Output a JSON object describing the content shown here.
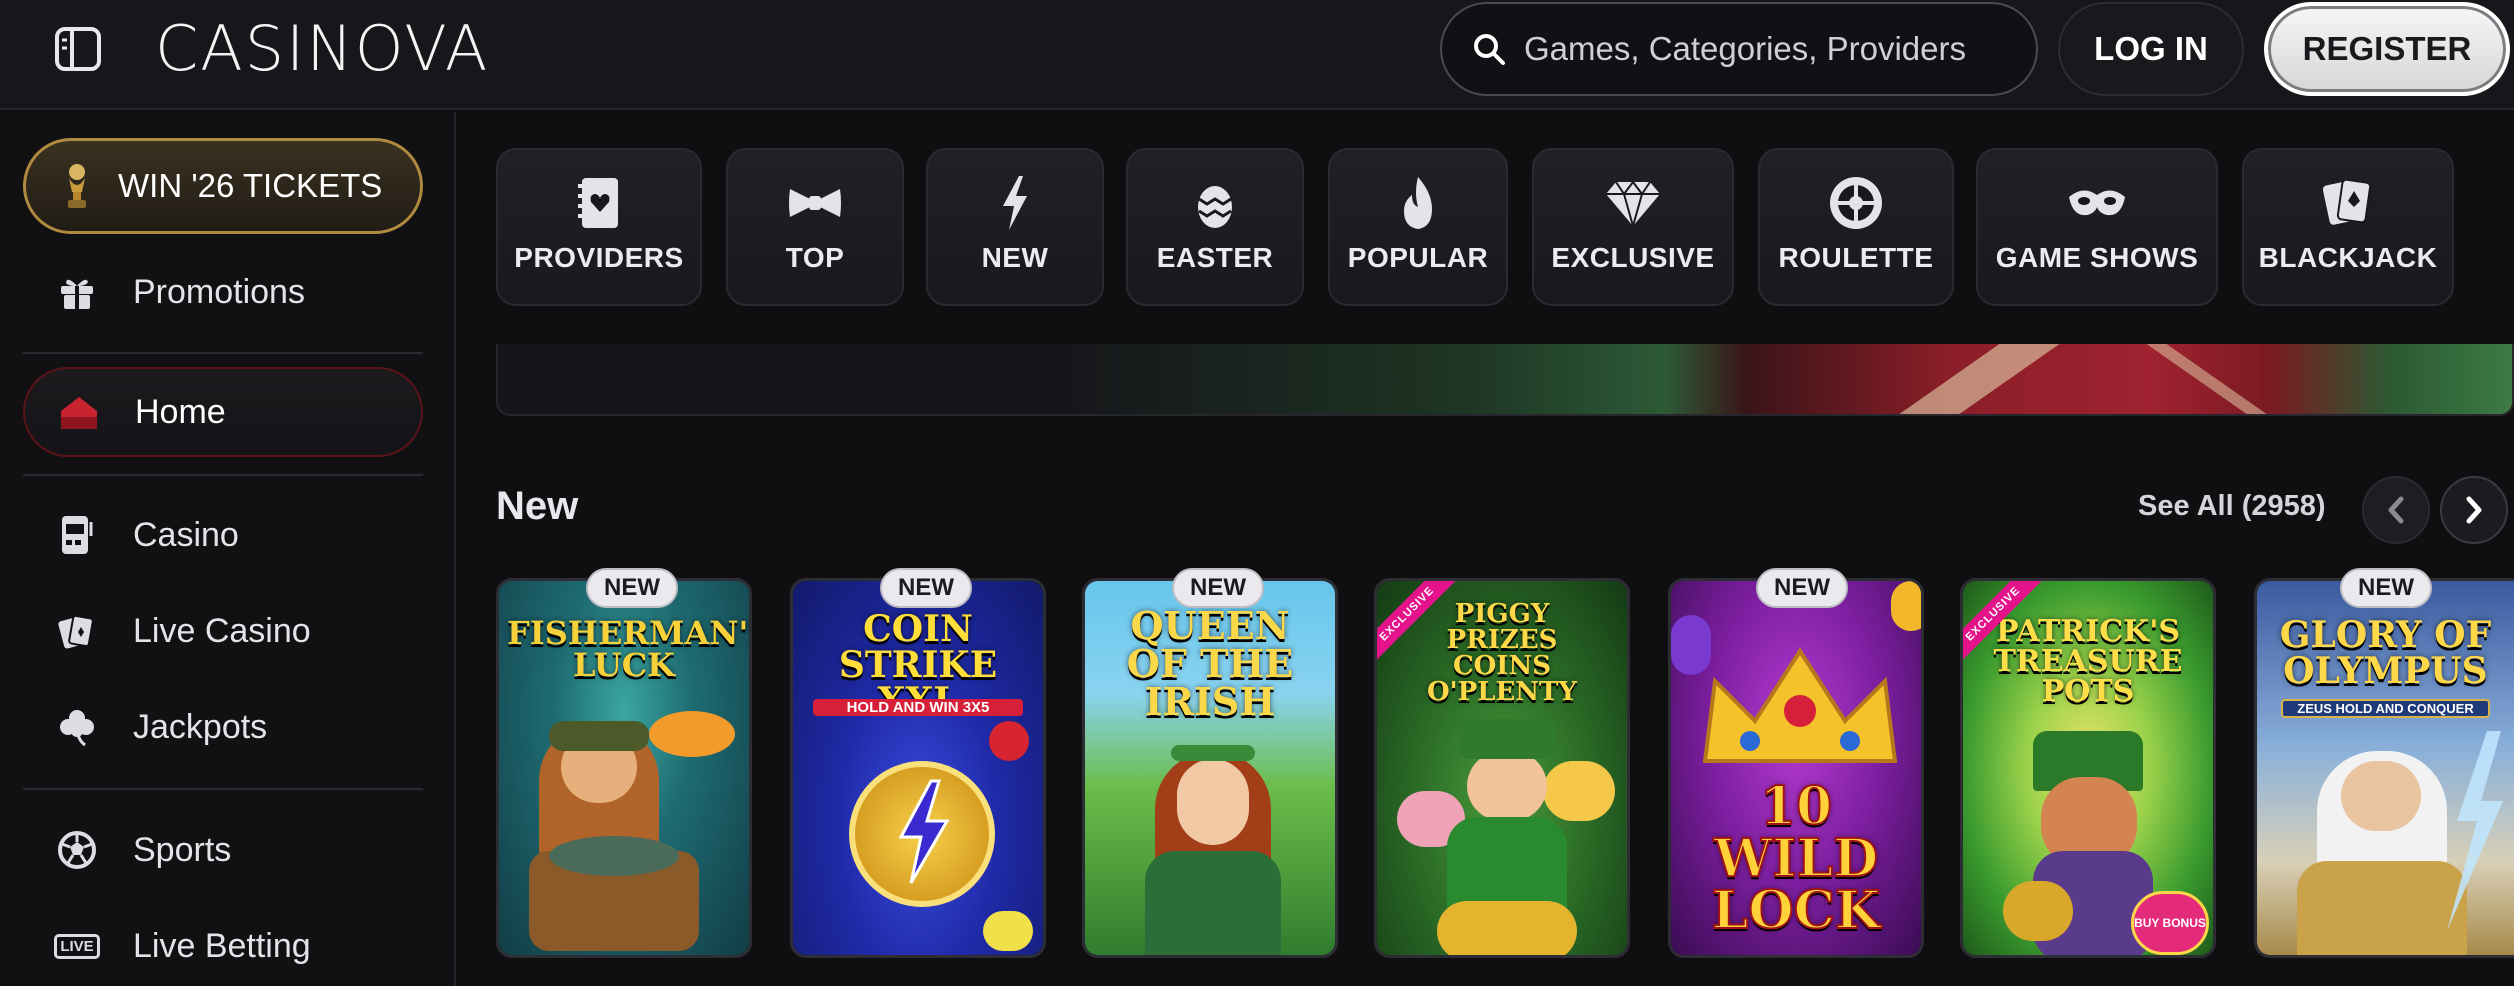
{
  "header": {
    "logo": "CASINOVA",
    "search_placeholder": "Games, Categories, Providers",
    "login_label": "LOG IN",
    "register_label": "REGISTER"
  },
  "sidebar": {
    "promo_label": "WIN '26 TICKETS",
    "items": [
      {
        "label": "Promotions",
        "icon": "gift-icon"
      },
      {
        "label": "Home",
        "icon": "home-icon"
      },
      {
        "label": "Casino",
        "icon": "slot-machine-icon"
      },
      {
        "label": "Live Casino",
        "icon": "cards-icon"
      },
      {
        "label": "Jackpots",
        "icon": "clover-icon"
      },
      {
        "label": "Sports",
        "icon": "soccer-ball-icon"
      },
      {
        "label": "Live Betting",
        "icon": "live-icon",
        "icon_text": "LIVE"
      }
    ]
  },
  "categories": [
    {
      "label": "PROVIDERS",
      "icon": "book-heart-icon"
    },
    {
      "label": "TOP",
      "icon": "bowtie-icon"
    },
    {
      "label": "NEW",
      "icon": "lightning-icon"
    },
    {
      "label": "EASTER",
      "icon": "egg-icon"
    },
    {
      "label": "POPULAR",
      "icon": "flame-icon"
    },
    {
      "label": "EXCLUSIVE",
      "icon": "diamond-icon"
    },
    {
      "label": "ROULETTE",
      "icon": "roulette-icon"
    },
    {
      "label": "GAME SHOWS",
      "icon": "mask-icon"
    },
    {
      "label": "BLACKJACK",
      "icon": "playing-cards-icon"
    }
  ],
  "new_section": {
    "title": "New",
    "see_all": "See All (2958)",
    "games": [
      {
        "title": "FISHERMAN'S LUCK",
        "badge": "NEW",
        "ribbon": ""
      },
      {
        "title": "COIN STRIKE XXL",
        "subtitle": "HOLD AND WIN 3X5",
        "badge": "NEW",
        "ribbon": ""
      },
      {
        "title": "QUEEN OF THE IRISH",
        "badge": "NEW",
        "ribbon": ""
      },
      {
        "title": "PIGGY PRIZES COINS O'PLENTY",
        "badge": "",
        "ribbon": "EXCLUSIVE"
      },
      {
        "title": "10 WILD LOCK",
        "badge": "NEW",
        "ribbon": ""
      },
      {
        "title": "PATRICK'S TREASURE POTS",
        "subtitle": "BUY BONUS",
        "badge": "",
        "ribbon": "EXCLUSIVE"
      },
      {
        "title": "GLORY OF OLYMPUS",
        "subtitle": "ZEUS HOLD AND CONQUER",
        "badge": "NEW",
        "ribbon": ""
      }
    ]
  },
  "colors": {
    "background": "#0f0f12",
    "header": "#16161b",
    "gold_accent": "#b08a3e",
    "home_accent": "#c8232f",
    "register_bg": "#eeeeee"
  }
}
